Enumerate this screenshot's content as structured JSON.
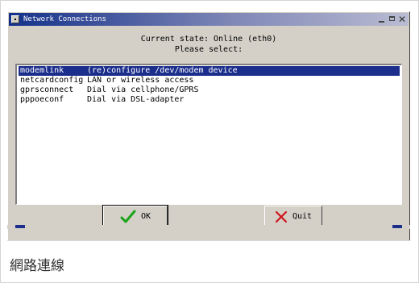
{
  "window": {
    "title": "Network Connections",
    "controls": [
      "minimize",
      "maximize",
      "close"
    ],
    "close_glyph": "✕"
  },
  "header": {
    "state_line": "Current state: Online (eth0)",
    "prompt": "Please select:"
  },
  "list": {
    "items": [
      {
        "name": "modemlink",
        "desc": "(re)configure /dev/modem device",
        "selected": true
      },
      {
        "name": "netcardconfig",
        "desc": "LAN or wireless access",
        "selected": false
      },
      {
        "name": "gprsconnect",
        "desc": "Dial via cellphone/GPRS",
        "selected": false
      },
      {
        "name": "pppoeconf",
        "desc": "Dial via DSL-adapter",
        "selected": false
      }
    ]
  },
  "buttons": {
    "ok_label": "OK",
    "ok_icon": "checkmark-icon",
    "quit_label": "Quit",
    "quit_icon": "x-icon"
  },
  "caption": "網路連線",
  "colors": {
    "selection": "#1c2e8c",
    "titlebar_start": "#13308a",
    "check_green": "#1aa31a",
    "quit_red": "#d0141a"
  }
}
